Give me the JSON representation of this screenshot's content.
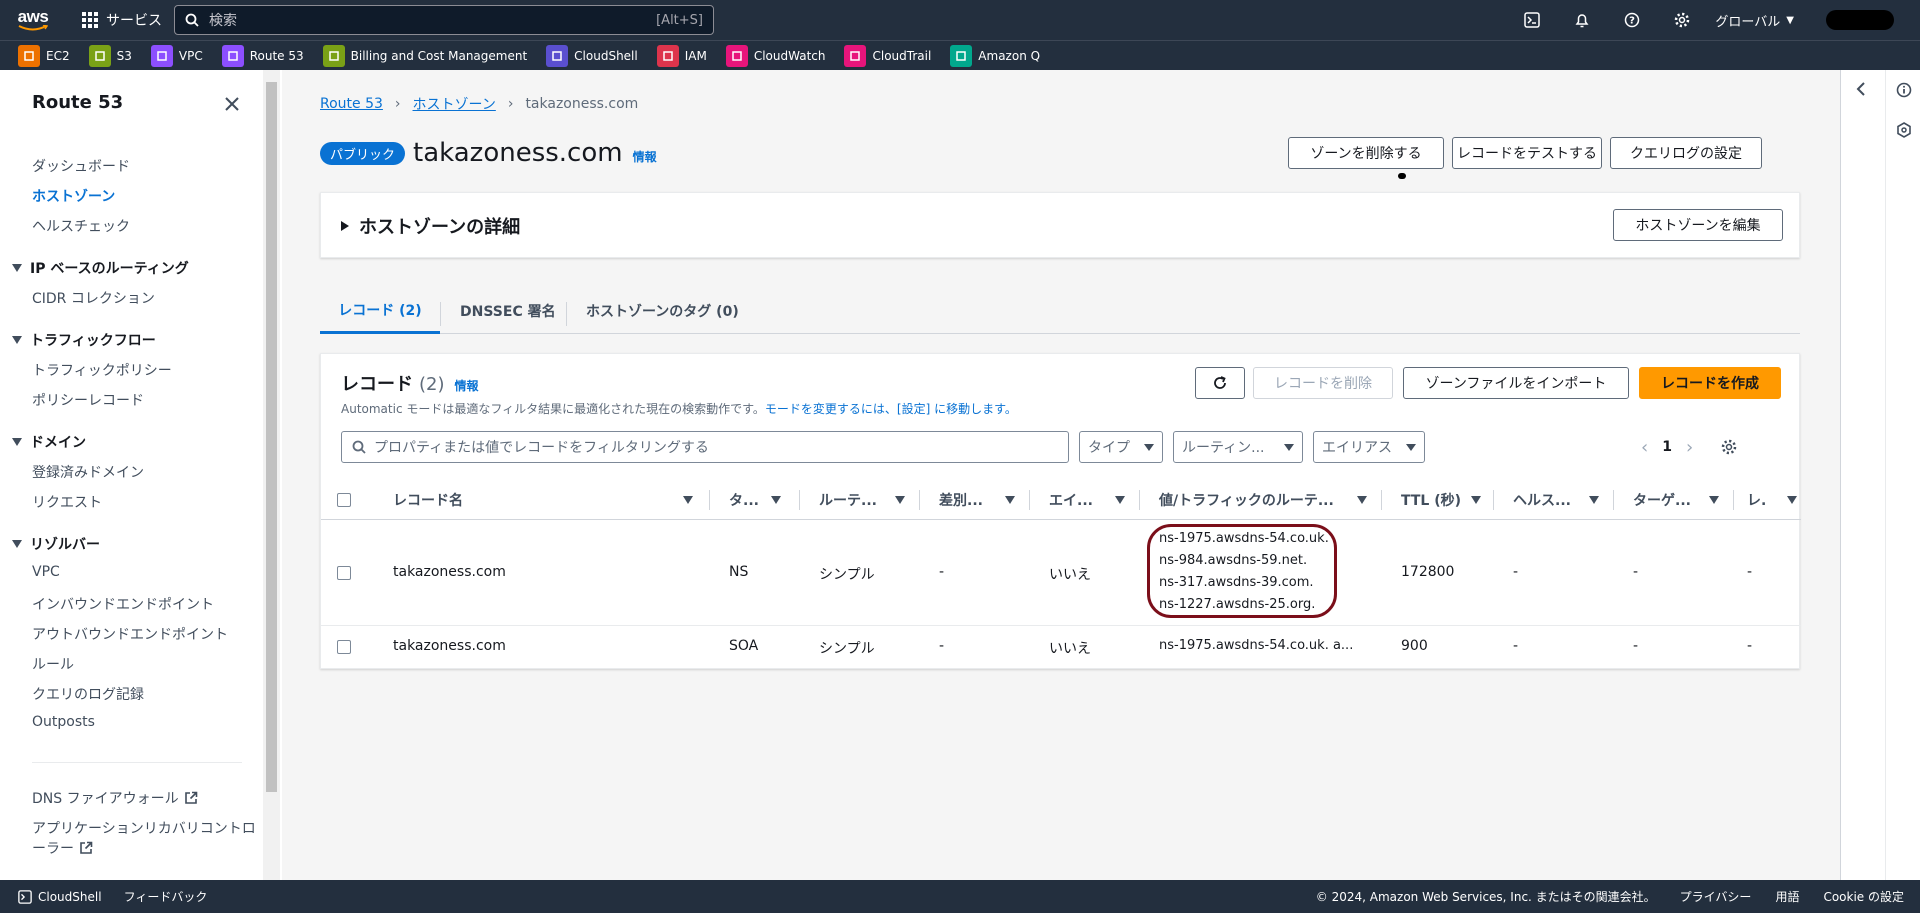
{
  "topnav": {
    "logo": "aws",
    "services_label": "サービス",
    "search_placeholder": "検索",
    "search_shortcut": "[Alt+S]",
    "region_label": "グローバル"
  },
  "favorites": [
    {
      "label": "EC2",
      "color": "#ed7100"
    },
    {
      "label": "S3",
      "color": "#7aa116"
    },
    {
      "label": "VPC",
      "color": "#8c4fff"
    },
    {
      "label": "Route 53",
      "color": "#8c4fff"
    },
    {
      "label": "Billing and Cost Management",
      "color": "#7aa116"
    },
    {
      "label": "CloudShell",
      "color": "#5a4fcf"
    },
    {
      "label": "IAM",
      "color": "#dd344c"
    },
    {
      "label": "CloudWatch",
      "color": "#e7157b"
    },
    {
      "label": "CloudTrail",
      "color": "#e7157b"
    },
    {
      "label": "Amazon Q",
      "color": "#01a88d"
    }
  ],
  "sidebar": {
    "title": "Route 53",
    "items": [
      "ダッシュボード",
      "ホストゾーン",
      "ヘルスチェック"
    ],
    "sections": [
      {
        "label": "IP ベースのルーティング",
        "items": [
          "CIDR コレクション"
        ]
      },
      {
        "label": "トラフィックフロー",
        "items": [
          "トラフィックポリシー",
          "ポリシーレコード"
        ]
      },
      {
        "label": "ドメイン",
        "items": [
          "登録済みドメイン",
          "リクエスト"
        ]
      },
      {
        "label": "リゾルバー",
        "items": [
          "VPC",
          "インバウンドエンドポイント",
          "アウトバウンドエンドポイント",
          "ルール",
          "クエリのログ記録",
          "Outposts"
        ]
      }
    ],
    "external": [
      "DNS ファイアウォール",
      "アプリケーションリカバリコントロ",
      "ーラー"
    ]
  },
  "breadcrumb": [
    "Route 53",
    "ホストゾーン",
    "takazoness.com"
  ],
  "header": {
    "badge": "パブリック",
    "title": "takazoness.com",
    "info": "情報",
    "buttons": [
      "ゾーンを削除する",
      "レコードをテストする",
      "クエリログの設定"
    ]
  },
  "details": {
    "title": "ホストゾーンの詳細",
    "edit_button": "ホストゾーンを編集"
  },
  "tabs": [
    "レコード (2)",
    "DNSSEC 署名",
    "ホストゾーンのタグ (0)"
  ],
  "records": {
    "title": "レコード",
    "count": "(2)",
    "info": "情報",
    "desc_prefix": "Automatic モードは最適なフィルタ結果に最適化された現在の検索動作です。",
    "desc_link": "モードを変更するには、[設定] に移動します。",
    "delete_button": "レコードを削除",
    "import_button": "ゾーンファイルをインポート",
    "create_button": "レコードを作成",
    "filter_placeholder": "プロパティまたは値でレコードをフィルタリングする",
    "filters": [
      "タイプ",
      "ルーティン...",
      "エイリアス"
    ],
    "page": "1",
    "columns": [
      "レコード名",
      "タ...",
      "ルーテ...",
      "差別...",
      "エイ...",
      "値/トラフィックのルーテ...",
      "TTL (秒)",
      "ヘルス...",
      "ターゲ...",
      "レ."
    ],
    "rows": [
      {
        "name": "takazoness.com",
        "type": "NS",
        "routing": "シンプル",
        "diff": "-",
        "alias": "いいえ",
        "values": [
          "ns-1975.awsdns-54.co.uk.",
          "ns-984.awsdns-59.net.",
          "ns-317.awsdns-39.com.",
          "ns-1227.awsdns-25.org."
        ],
        "ttl": "172800",
        "health": "-",
        "target": "-",
        "rec": "-"
      },
      {
        "name": "takazoness.com",
        "type": "SOA",
        "routing": "シンプル",
        "diff": "-",
        "alias": "いいえ",
        "values": [
          "ns-1975.awsdns-54.co.uk. a..."
        ],
        "ttl": "900",
        "health": "-",
        "target": "-",
        "rec": "-"
      }
    ]
  },
  "footer": {
    "cloudshell": "CloudShell",
    "feedback": "フィードバック",
    "copyright": "© 2024, Amazon Web Services, Inc. またはその関連会社。",
    "privacy": "プライバシー",
    "terms": "用語",
    "cookie": "Cookie の設定"
  }
}
